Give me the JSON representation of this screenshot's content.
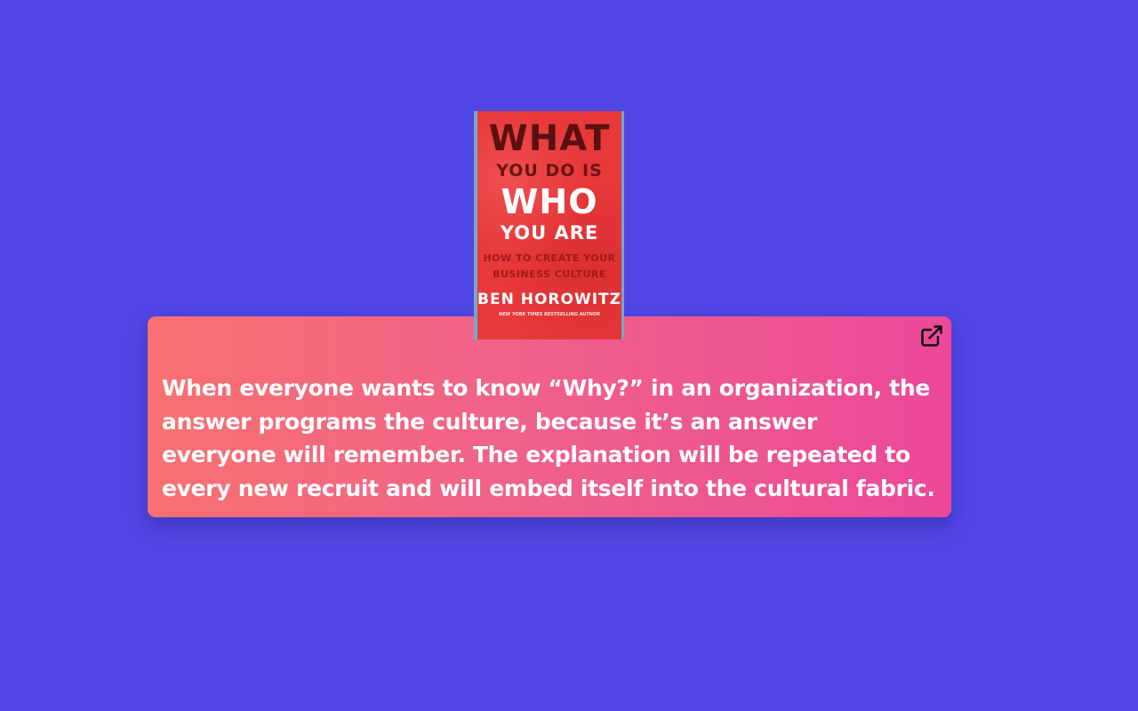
{
  "quote": {
    "text": "When everyone wants to know “Why?” in an organization, the answer programs the culture, because it’s an answer everyone will remember. The explanation will be repeated to every new recruit and will embed itself into the cultural fabric."
  },
  "book": {
    "cover_title_line1": "WHAT",
    "cover_title_line2": "YOU DO IS",
    "cover_title_line3": "WHO",
    "cover_title_line4": "YOU ARE",
    "cover_subtitle_line1": "HOW TO CREATE YOUR",
    "cover_subtitle_line2": "BUSINESS CULTURE",
    "cover_author": "BEN HOROWITZ",
    "cover_tagline": "NEW YORK TIMES BESTSELLING AUTHOR"
  },
  "icons": {
    "open_link": "external-link-icon"
  },
  "colors": {
    "background": "#4f46e5",
    "card_gradient_start": "#f87171",
    "card_gradient_end": "#ec4899",
    "quote_text": "#ffffff"
  }
}
